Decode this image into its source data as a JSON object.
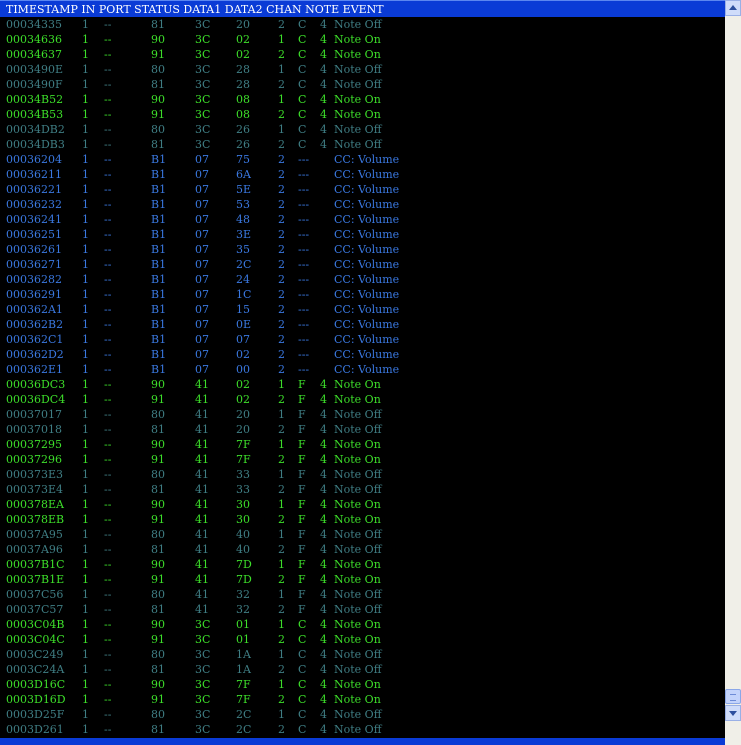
{
  "header": "TIMESTAMP IN PORT STATUS DATA1 DATA2 CHAN NOTE EVENT",
  "colors": {
    "note_on": "#3ddf2a",
    "note_off": "#3f7e84",
    "cc": "#3a78e0",
    "header_bg": "#0a3bd6",
    "background": "#000000"
  },
  "rows": [
    {
      "ts": "00034335",
      "in": "1",
      "port": "--",
      "status": "81",
      "d1": "3C",
      "d2": "20",
      "chan": "2",
      "note": "C",
      "oct": "4",
      "event": "Note Off",
      "kind": "off"
    },
    {
      "ts": "00034636",
      "in": "1",
      "port": "--",
      "status": "90",
      "d1": "3C",
      "d2": "02",
      "chan": "1",
      "note": "C",
      "oct": "4",
      "event": "Note On",
      "kind": "on"
    },
    {
      "ts": "00034637",
      "in": "1",
      "port": "--",
      "status": "91",
      "d1": "3C",
      "d2": "02",
      "chan": "2",
      "note": "C",
      "oct": "4",
      "event": "Note On",
      "kind": "on"
    },
    {
      "ts": "0003490E",
      "in": "1",
      "port": "--",
      "status": "80",
      "d1": "3C",
      "d2": "28",
      "chan": "1",
      "note": "C",
      "oct": "4",
      "event": "Note Off",
      "kind": "off"
    },
    {
      "ts": "0003490F",
      "in": "1",
      "port": "--",
      "status": "81",
      "d1": "3C",
      "d2": "28",
      "chan": "2",
      "note": "C",
      "oct": "4",
      "event": "Note Off",
      "kind": "off"
    },
    {
      "ts": "00034B52",
      "in": "1",
      "port": "--",
      "status": "90",
      "d1": "3C",
      "d2": "08",
      "chan": "1",
      "note": "C",
      "oct": "4",
      "event": "Note On",
      "kind": "on"
    },
    {
      "ts": "00034B53",
      "in": "1",
      "port": "--",
      "status": "91",
      "d1": "3C",
      "d2": "08",
      "chan": "2",
      "note": "C",
      "oct": "4",
      "event": "Note On",
      "kind": "on"
    },
    {
      "ts": "00034DB2",
      "in": "1",
      "port": "--",
      "status": "80",
      "d1": "3C",
      "d2": "26",
      "chan": "1",
      "note": "C",
      "oct": "4",
      "event": "Note Off",
      "kind": "off"
    },
    {
      "ts": "00034DB3",
      "in": "1",
      "port": "--",
      "status": "81",
      "d1": "3C",
      "d2": "26",
      "chan": "2",
      "note": "C",
      "oct": "4",
      "event": "Note Off",
      "kind": "off"
    },
    {
      "ts": "00036204",
      "in": "1",
      "port": "--",
      "status": "B1",
      "d1": "07",
      "d2": "75",
      "chan": "2",
      "note": "---",
      "oct": "",
      "event": "CC: Volume",
      "kind": "cc"
    },
    {
      "ts": "00036211",
      "in": "1",
      "port": "--",
      "status": "B1",
      "d1": "07",
      "d2": "6A",
      "chan": "2",
      "note": "---",
      "oct": "",
      "event": "CC: Volume",
      "kind": "cc"
    },
    {
      "ts": "00036221",
      "in": "1",
      "port": "--",
      "status": "B1",
      "d1": "07",
      "d2": "5E",
      "chan": "2",
      "note": "---",
      "oct": "",
      "event": "CC: Volume",
      "kind": "cc"
    },
    {
      "ts": "00036232",
      "in": "1",
      "port": "--",
      "status": "B1",
      "d1": "07",
      "d2": "53",
      "chan": "2",
      "note": "---",
      "oct": "",
      "event": "CC: Volume",
      "kind": "cc"
    },
    {
      "ts": "00036241",
      "in": "1",
      "port": "--",
      "status": "B1",
      "d1": "07",
      "d2": "48",
      "chan": "2",
      "note": "---",
      "oct": "",
      "event": "CC: Volume",
      "kind": "cc"
    },
    {
      "ts": "00036251",
      "in": "1",
      "port": "--",
      "status": "B1",
      "d1": "07",
      "d2": "3E",
      "chan": "2",
      "note": "---",
      "oct": "",
      "event": "CC: Volume",
      "kind": "cc"
    },
    {
      "ts": "00036261",
      "in": "1",
      "port": "--",
      "status": "B1",
      "d1": "07",
      "d2": "35",
      "chan": "2",
      "note": "---",
      "oct": "",
      "event": "CC: Volume",
      "kind": "cc"
    },
    {
      "ts": "00036271",
      "in": "1",
      "port": "--",
      "status": "B1",
      "d1": "07",
      "d2": "2C",
      "chan": "2",
      "note": "---",
      "oct": "",
      "event": "CC: Volume",
      "kind": "cc"
    },
    {
      "ts": "00036282",
      "in": "1",
      "port": "--",
      "status": "B1",
      "d1": "07",
      "d2": "24",
      "chan": "2",
      "note": "---",
      "oct": "",
      "event": "CC: Volume",
      "kind": "cc"
    },
    {
      "ts": "00036291",
      "in": "1",
      "port": "--",
      "status": "B1",
      "d1": "07",
      "d2": "1C",
      "chan": "2",
      "note": "---",
      "oct": "",
      "event": "CC: Volume",
      "kind": "cc"
    },
    {
      "ts": "000362A1",
      "in": "1",
      "port": "--",
      "status": "B1",
      "d1": "07",
      "d2": "15",
      "chan": "2",
      "note": "---",
      "oct": "",
      "event": "CC: Volume",
      "kind": "cc"
    },
    {
      "ts": "000362B2",
      "in": "1",
      "port": "--",
      "status": "B1",
      "d1": "07",
      "d2": "0E",
      "chan": "2",
      "note": "---",
      "oct": "",
      "event": "CC: Volume",
      "kind": "cc"
    },
    {
      "ts": "000362C1",
      "in": "1",
      "port": "--",
      "status": "B1",
      "d1": "07",
      "d2": "07",
      "chan": "2",
      "note": "---",
      "oct": "",
      "event": "CC: Volume",
      "kind": "cc"
    },
    {
      "ts": "000362D2",
      "in": "1",
      "port": "--",
      "status": "B1",
      "d1": "07",
      "d2": "02",
      "chan": "2",
      "note": "---",
      "oct": "",
      "event": "CC: Volume",
      "kind": "cc"
    },
    {
      "ts": "000362E1",
      "in": "1",
      "port": "--",
      "status": "B1",
      "d1": "07",
      "d2": "00",
      "chan": "2",
      "note": "---",
      "oct": "",
      "event": "CC: Volume",
      "kind": "cc"
    },
    {
      "ts": "00036DC3",
      "in": "1",
      "port": "--",
      "status": "90",
      "d1": "41",
      "d2": "02",
      "chan": "1",
      "note": "F",
      "oct": "4",
      "event": "Note On",
      "kind": "on"
    },
    {
      "ts": "00036DC4",
      "in": "1",
      "port": "--",
      "status": "91",
      "d1": "41",
      "d2": "02",
      "chan": "2",
      "note": "F",
      "oct": "4",
      "event": "Note On",
      "kind": "on"
    },
    {
      "ts": "00037017",
      "in": "1",
      "port": "--",
      "status": "80",
      "d1": "41",
      "d2": "20",
      "chan": "1",
      "note": "F",
      "oct": "4",
      "event": "Note Off",
      "kind": "off"
    },
    {
      "ts": "00037018",
      "in": "1",
      "port": "--",
      "status": "81",
      "d1": "41",
      "d2": "20",
      "chan": "2",
      "note": "F",
      "oct": "4",
      "event": "Note Off",
      "kind": "off"
    },
    {
      "ts": "00037295",
      "in": "1",
      "port": "--",
      "status": "90",
      "d1": "41",
      "d2": "7F",
      "chan": "1",
      "note": "F",
      "oct": "4",
      "event": "Note On",
      "kind": "on"
    },
    {
      "ts": "00037296",
      "in": "1",
      "port": "--",
      "status": "91",
      "d1": "41",
      "d2": "7F",
      "chan": "2",
      "note": "F",
      "oct": "4",
      "event": "Note On",
      "kind": "on"
    },
    {
      "ts": "000373E3",
      "in": "1",
      "port": "--",
      "status": "80",
      "d1": "41",
      "d2": "33",
      "chan": "1",
      "note": "F",
      "oct": "4",
      "event": "Note Off",
      "kind": "off"
    },
    {
      "ts": "000373E4",
      "in": "1",
      "port": "--",
      "status": "81",
      "d1": "41",
      "d2": "33",
      "chan": "2",
      "note": "F",
      "oct": "4",
      "event": "Note Off",
      "kind": "off"
    },
    {
      "ts": "000378EA",
      "in": "1",
      "port": "--",
      "status": "90",
      "d1": "41",
      "d2": "30",
      "chan": "1",
      "note": "F",
      "oct": "4",
      "event": "Note On",
      "kind": "on"
    },
    {
      "ts": "000378EB",
      "in": "1",
      "port": "--",
      "status": "91",
      "d1": "41",
      "d2": "30",
      "chan": "2",
      "note": "F",
      "oct": "4",
      "event": "Note On",
      "kind": "on"
    },
    {
      "ts": "00037A95",
      "in": "1",
      "port": "--",
      "status": "80",
      "d1": "41",
      "d2": "40",
      "chan": "1",
      "note": "F",
      "oct": "4",
      "event": "Note Off",
      "kind": "off"
    },
    {
      "ts": "00037A96",
      "in": "1",
      "port": "--",
      "status": "81",
      "d1": "41",
      "d2": "40",
      "chan": "2",
      "note": "F",
      "oct": "4",
      "event": "Note Off",
      "kind": "off"
    },
    {
      "ts": "00037B1C",
      "in": "1",
      "port": "--",
      "status": "90",
      "d1": "41",
      "d2": "7D",
      "chan": "1",
      "note": "F",
      "oct": "4",
      "event": "Note On",
      "kind": "on"
    },
    {
      "ts": "00037B1E",
      "in": "1",
      "port": "--",
      "status": "91",
      "d1": "41",
      "d2": "7D",
      "chan": "2",
      "note": "F",
      "oct": "4",
      "event": "Note On",
      "kind": "on"
    },
    {
      "ts": "00037C56",
      "in": "1",
      "port": "--",
      "status": "80",
      "d1": "41",
      "d2": "32",
      "chan": "1",
      "note": "F",
      "oct": "4",
      "event": "Note Off",
      "kind": "off"
    },
    {
      "ts": "00037C57",
      "in": "1",
      "port": "--",
      "status": "81",
      "d1": "41",
      "d2": "32",
      "chan": "2",
      "note": "F",
      "oct": "4",
      "event": "Note Off",
      "kind": "off"
    },
    {
      "ts": "0003C04B",
      "in": "1",
      "port": "--",
      "status": "90",
      "d1": "3C",
      "d2": "01",
      "chan": "1",
      "note": "C",
      "oct": "4",
      "event": "Note On",
      "kind": "on"
    },
    {
      "ts": "0003C04C",
      "in": "1",
      "port": "--",
      "status": "91",
      "d1": "3C",
      "d2": "01",
      "chan": "2",
      "note": "C",
      "oct": "4",
      "event": "Note On",
      "kind": "on"
    },
    {
      "ts": "0003C249",
      "in": "1",
      "port": "--",
      "status": "80",
      "d1": "3C",
      "d2": "1A",
      "chan": "1",
      "note": "C",
      "oct": "4",
      "event": "Note Off",
      "kind": "off"
    },
    {
      "ts": "0003C24A",
      "in": "1",
      "port": "--",
      "status": "81",
      "d1": "3C",
      "d2": "1A",
      "chan": "2",
      "note": "C",
      "oct": "4",
      "event": "Note Off",
      "kind": "off"
    },
    {
      "ts": "0003D16C",
      "in": "1",
      "port": "--",
      "status": "90",
      "d1": "3C",
      "d2": "7F",
      "chan": "1",
      "note": "C",
      "oct": "4",
      "event": "Note On",
      "kind": "on"
    },
    {
      "ts": "0003D16D",
      "in": "1",
      "port": "--",
      "status": "91",
      "d1": "3C",
      "d2": "7F",
      "chan": "2",
      "note": "C",
      "oct": "4",
      "event": "Note On",
      "kind": "on"
    },
    {
      "ts": "0003D25F",
      "in": "1",
      "port": "--",
      "status": "80",
      "d1": "3C",
      "d2": "2C",
      "chan": "1",
      "note": "C",
      "oct": "4",
      "event": "Note Off",
      "kind": "off"
    },
    {
      "ts": "0003D261",
      "in": "1",
      "port": "--",
      "status": "81",
      "d1": "3C",
      "d2": "2C",
      "chan": "2",
      "note": "C",
      "oct": "4",
      "event": "Note Off",
      "kind": "off"
    }
  ]
}
